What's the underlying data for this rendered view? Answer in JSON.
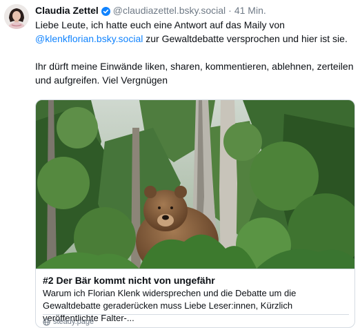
{
  "post": {
    "author_name": "Claudia Zettel",
    "author_handle": "@claudiazettel.bsky.social",
    "separator": "·",
    "timestamp": "41 Min.",
    "text": {
      "line1_before": "Liebe Leute, ich hatte euch eine Antwort auf das Maily von",
      "mention": "@klenkflorian.bsky.social",
      "line2_after": " zur Gewaltdebatte versprochen und hier ist sie.",
      "paragraph2": "Ihr dürft meine Einwände liken, sharen, kommentieren, ablehnen, zerteilen und aufgreifen. Viel Vergnügen"
    },
    "link_card": {
      "title": "#2 Der Bär kommt nicht von ungefähr",
      "description": "Warum ich Florian Klenk widersprechen und die Debatte um die Gewaltdebatte geraderücken muss Liebe Leser:innen, Kürzlich veröffentlichte Falter-...",
      "domain": "steady.page"
    }
  },
  "icons": {
    "verified": "verified-badge-icon",
    "globe": "globe-icon"
  },
  "colors": {
    "link": "#1083fe",
    "muted": "#6f7a86",
    "border": "#d4dbe2",
    "verified": "#1083fe"
  }
}
